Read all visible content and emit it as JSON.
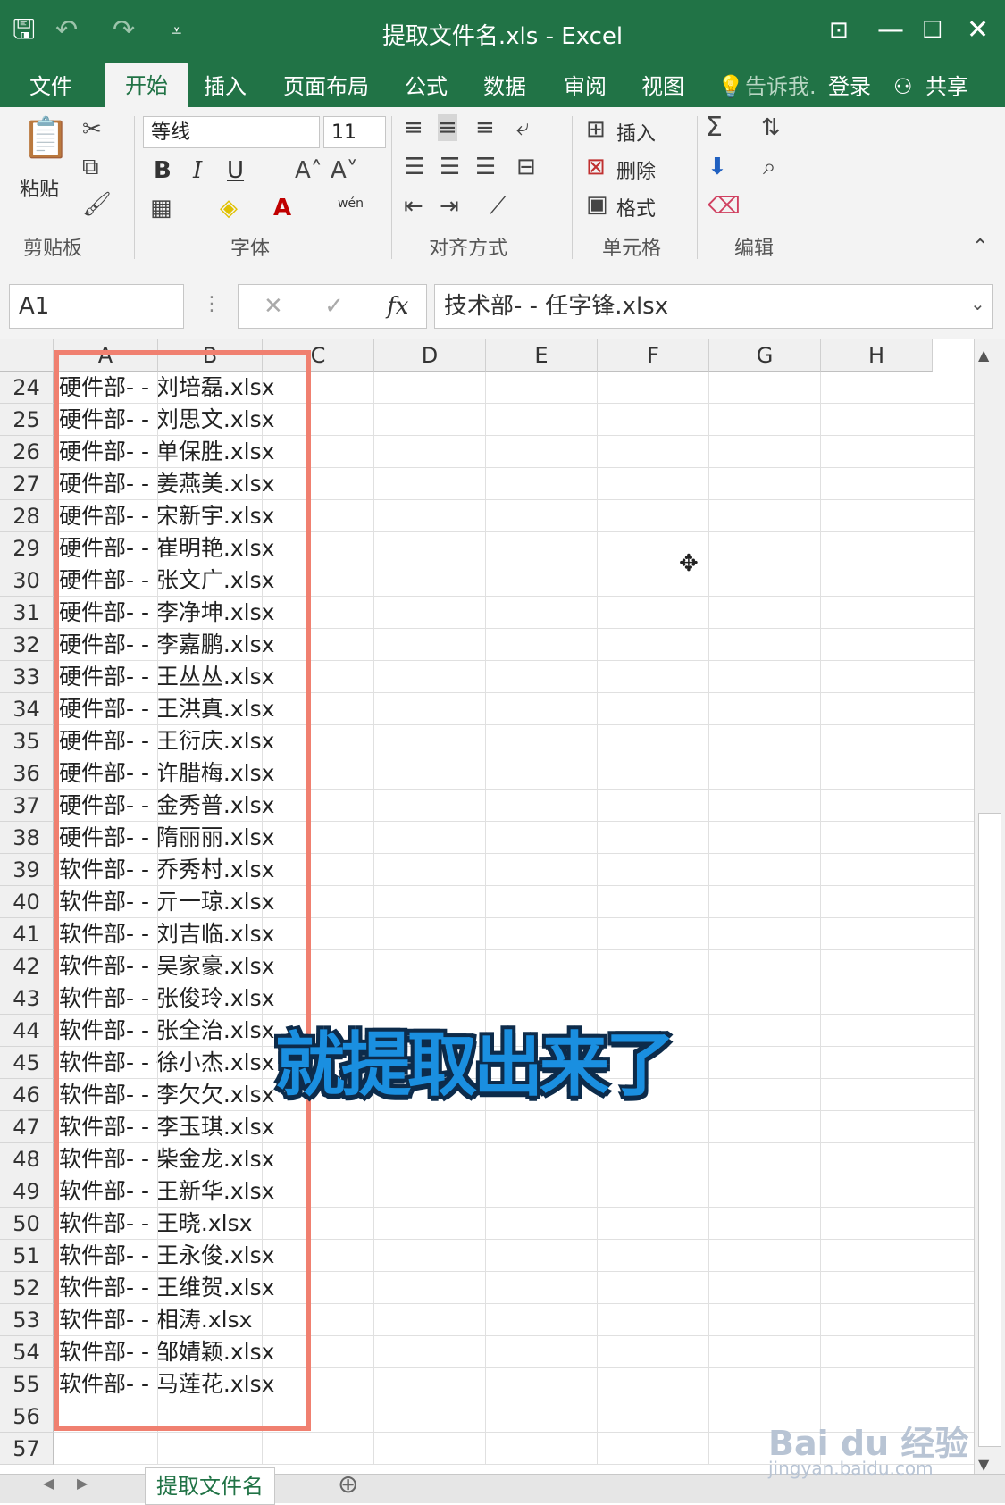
{
  "window": {
    "title": "提取文件名.xls - Excel",
    "colors": {
      "brand": "#217346",
      "highlight_box": "#f08070",
      "overlay_text": "#1a8fe0"
    }
  },
  "tabs": {
    "file": "文件",
    "home": "开始",
    "insert": "插入",
    "page_layout": "页面布局",
    "formulas": "公式",
    "data": "数据",
    "review": "审阅",
    "view": "视图",
    "tell_me": "告诉我.",
    "login": "登录",
    "share": "共享"
  },
  "ribbon": {
    "paste": "粘贴",
    "clipboard_group": "剪贴板",
    "font_name": "等线",
    "font_size": "11",
    "bold": "B",
    "italic": "I",
    "underline": "U",
    "font_group": "字体",
    "phonetic": "wén",
    "alignment_group": "对齐方式",
    "insert_cells": "插入",
    "delete_cells": "删除",
    "format_cells": "格式",
    "cells_group": "单元格",
    "editing_group": "编辑"
  },
  "formula_bar": {
    "name_box": "A1",
    "fx": "fx",
    "content": "技术部- - 任字锋.xlsx"
  },
  "grid": {
    "columns": [
      "A",
      "B",
      "C",
      "D",
      "E",
      "F",
      "G",
      "H"
    ],
    "rows": [
      {
        "n": "24",
        "v": "硬件部- - 刘培磊.xlsx"
      },
      {
        "n": "25",
        "v": "硬件部- - 刘思文.xlsx"
      },
      {
        "n": "26",
        "v": "硬件部- - 单保胜.xlsx"
      },
      {
        "n": "27",
        "v": "硬件部- - 姜燕美.xlsx"
      },
      {
        "n": "28",
        "v": "硬件部- - 宋新宇.xlsx"
      },
      {
        "n": "29",
        "v": "硬件部- - 崔明艳.xlsx"
      },
      {
        "n": "30",
        "v": "硬件部- - 张文广.xlsx"
      },
      {
        "n": "31",
        "v": "硬件部- - 李净坤.xlsx"
      },
      {
        "n": "32",
        "v": "硬件部- - 李嘉鹏.xlsx"
      },
      {
        "n": "33",
        "v": "硬件部- - 王丛丛.xlsx"
      },
      {
        "n": "34",
        "v": "硬件部- - 王洪真.xlsx"
      },
      {
        "n": "35",
        "v": "硬件部- - 王衍庆.xlsx"
      },
      {
        "n": "36",
        "v": "硬件部- - 许腊梅.xlsx"
      },
      {
        "n": "37",
        "v": "硬件部- - 金秀普.xlsx"
      },
      {
        "n": "38",
        "v": "硬件部- - 隋丽丽.xlsx"
      },
      {
        "n": "39",
        "v": "软件部- - 乔秀村.xlsx"
      },
      {
        "n": "40",
        "v": "软件部- - 亓一琼.xlsx"
      },
      {
        "n": "41",
        "v": "软件部- - 刘吉临.xlsx"
      },
      {
        "n": "42",
        "v": "软件部- - 吴家豪.xlsx"
      },
      {
        "n": "43",
        "v": "软件部- - 张俊玲.xlsx"
      },
      {
        "n": "44",
        "v": "软件部- - 张全治.xlsx"
      },
      {
        "n": "45",
        "v": "软件部- - 徐小杰.xlsx"
      },
      {
        "n": "46",
        "v": "软件部- - 李欠欠.xlsx"
      },
      {
        "n": "47",
        "v": "软件部- - 李玉琪.xlsx"
      },
      {
        "n": "48",
        "v": "软件部- - 柴金龙.xlsx"
      },
      {
        "n": "49",
        "v": "软件部- - 王新华.xlsx"
      },
      {
        "n": "50",
        "v": "软件部- - 王晓.xlsx"
      },
      {
        "n": "51",
        "v": "软件部- - 王永俊.xlsx"
      },
      {
        "n": "52",
        "v": "软件部- - 王维贺.xlsx"
      },
      {
        "n": "53",
        "v": "软件部- - 相涛.xlsx"
      },
      {
        "n": "54",
        "v": "软件部- - 邹婧颖.xlsx"
      },
      {
        "n": "55",
        "v": "软件部- - 马莲花.xlsx"
      },
      {
        "n": "56",
        "v": ""
      },
      {
        "n": "57",
        "v": ""
      }
    ]
  },
  "overlay": {
    "caption": "就提取出来了"
  },
  "sheet": {
    "tab_name": "提取文件名"
  },
  "watermark": {
    "brand": "Bai du 经验",
    "url": "jingyan.baidu.com"
  }
}
